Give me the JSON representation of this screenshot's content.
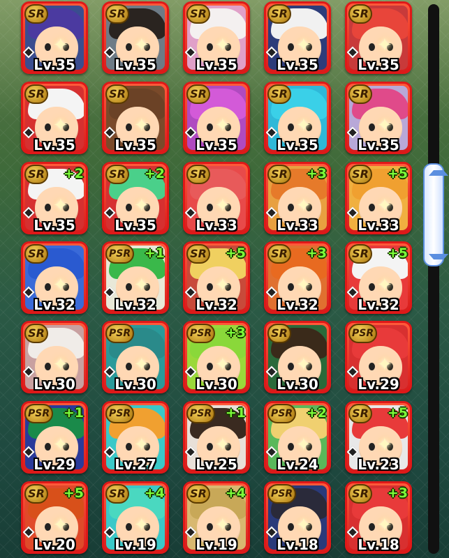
{
  "cards": [
    {
      "rarity": "SR",
      "level": "Lv.35",
      "bonus": "",
      "frame": "#e01818",
      "bg": "#3a4d8f",
      "hair": "#4b3aa0"
    },
    {
      "rarity": "SR",
      "level": "Lv.35",
      "bonus": "",
      "frame": "#e01818",
      "bg": "#6d7b86",
      "hair": "#2a2420"
    },
    {
      "rarity": "SR",
      "level": "Lv.35",
      "bonus": "",
      "frame": "#e01818",
      "bg": "#e0a0c8",
      "hair": "#f4f0f0"
    },
    {
      "rarity": "SR",
      "level": "Lv.35",
      "bonus": "",
      "frame": "#e01818",
      "bg": "#2d3c7a",
      "hair": "#f1f1f1"
    },
    {
      "rarity": "SR",
      "level": "Lv.35",
      "bonus": "",
      "frame": "#e01818",
      "bg": "#c83a3a",
      "hair": "#e8453a"
    },
    {
      "rarity": "SR",
      "level": "Lv.35",
      "bonus": "",
      "frame": "#e01818",
      "bg": "#d63030",
      "hair": "#f4f4f4"
    },
    {
      "rarity": "SR",
      "level": "Lv.35",
      "bonus": "",
      "frame": "#e01818",
      "bg": "#7a4a2a",
      "hair": "#6b4226"
    },
    {
      "rarity": "SR",
      "level": "Lv.35",
      "bonus": "",
      "frame": "#e01818",
      "bg": "#b04ac0",
      "hair": "#d35ad8"
    },
    {
      "rarity": "SR",
      "level": "Lv.35",
      "bonus": "",
      "frame": "#e01818",
      "bg": "#2fb8d8",
      "hair": "#3ad0e8"
    },
    {
      "rarity": "SR",
      "level": "Lv.35",
      "bonus": "",
      "frame": "#e01818",
      "bg": "#b8a8d8",
      "hair": "#e04a8a"
    },
    {
      "rarity": "SR",
      "level": "Lv.35",
      "bonus": "+2",
      "frame": "#e01818",
      "bg": "#d63030",
      "hair": "#f4f4f4"
    },
    {
      "rarity": "SR",
      "level": "Lv.35",
      "bonus": "+2",
      "frame": "#e01818",
      "bg": "#d63030",
      "hair": "#4ad08a"
    },
    {
      "rarity": "SR",
      "level": "Lv.33",
      "bonus": "",
      "frame": "#e01818",
      "bg": "#e84a4a",
      "hair": "#e85a5a"
    },
    {
      "rarity": "SR",
      "level": "Lv.33",
      "bonus": "+3",
      "frame": "#e01818",
      "bg": "#e8a040",
      "hair": "#e67a2a"
    },
    {
      "rarity": "SR",
      "level": "Lv.33",
      "bonus": "+5",
      "frame": "#e01818",
      "bg": "#f0b040",
      "hair": "#f0a030"
    },
    {
      "rarity": "SR",
      "level": "Lv.32",
      "bonus": "",
      "frame": "#e01818",
      "bg": "#3a6ad8",
      "hair": "#2a5ad0"
    },
    {
      "rarity": "PSR",
      "level": "Lv.32",
      "bonus": "+1",
      "frame": "#e01818",
      "bg": "#e8e8d8",
      "hair": "#3ab84a"
    },
    {
      "rarity": "SR",
      "level": "Lv.32",
      "bonus": "+5",
      "frame": "#e01818",
      "bg": "#c84a3a",
      "hair": "#f0d060"
    },
    {
      "rarity": "SR",
      "level": "Lv.32",
      "bonus": "+3",
      "frame": "#e01818",
      "bg": "#e07030",
      "hair": "#e86a20"
    },
    {
      "rarity": "SR",
      "level": "Lv.32",
      "bonus": "+5",
      "frame": "#e01818",
      "bg": "#e83a3a",
      "hair": "#f4f4f4"
    },
    {
      "rarity": "SR",
      "level": "Lv.30",
      "bonus": "",
      "frame": "#e01818",
      "bg": "#c8a0a0",
      "hair": "#f0ece8"
    },
    {
      "rarity": "PSR",
      "level": "Lv.30",
      "bonus": "",
      "frame": "#e01818",
      "bg": "#2a9a9a",
      "hair": "#2a8a8a"
    },
    {
      "rarity": "PSR",
      "level": "Lv.30",
      "bonus": "+3",
      "frame": "#e01818",
      "bg": "#9ad83a",
      "hair": "#8ad83a"
    },
    {
      "rarity": "SR",
      "level": "Lv.30",
      "bonus": "",
      "frame": "#e01818",
      "bg": "#2a6a3a",
      "hair": "#3a2a1a"
    },
    {
      "rarity": "PSR",
      "level": "Lv.29",
      "bonus": "",
      "frame": "#e01818",
      "bg": "#d83030",
      "hair": "#e83a3a"
    },
    {
      "rarity": "PSR",
      "level": "Lv.29",
      "bonus": "+1",
      "frame": "#e01818",
      "bg": "#2a3a9a",
      "hair": "#1a8a4a"
    },
    {
      "rarity": "PSR",
      "level": "Lv.27",
      "bonus": "",
      "frame": "#e01818",
      "bg": "#3ac8c8",
      "hair": "#f0a030"
    },
    {
      "rarity": "PSR",
      "level": "Lv.25",
      "bonus": "+1",
      "frame": "#e01818",
      "bg": "#e8e0d8",
      "hair": "#3a2a20"
    },
    {
      "rarity": "PSR",
      "level": "Lv.24",
      "bonus": "+2",
      "frame": "#e01818",
      "bg": "#5ab85a",
      "hair": "#f0d070"
    },
    {
      "rarity": "SR",
      "level": "Lv.23",
      "bonus": "+5",
      "frame": "#e01818",
      "bg": "#e8e8e8",
      "hair": "#e83a3a"
    },
    {
      "rarity": "SR",
      "level": "Lv.20",
      "bonus": "+5",
      "frame": "#e01818",
      "bg": "#e04a2a",
      "hair": "#d8501a"
    },
    {
      "rarity": "SR",
      "level": "Lv.19",
      "bonus": "+4",
      "frame": "#e01818",
      "bg": "#3ac8c8",
      "hair": "#4ad8c0"
    },
    {
      "rarity": "SR",
      "level": "Lv.19",
      "bonus": "+4",
      "frame": "#e01818",
      "bg": "#d8b870",
      "hair": "#c8a858"
    },
    {
      "rarity": "PSR",
      "level": "Lv.18",
      "bonus": "",
      "frame": "#e01818",
      "bg": "#2a3a7a",
      "hair": "#2a2a3a"
    },
    {
      "rarity": "SR",
      "level": "Lv.18",
      "bonus": "+3",
      "frame": "#e01818",
      "bg": "#d83030",
      "hair": "#e83a3a"
    }
  ],
  "icons": {
    "sparkle": "✦",
    "attribute_gem": "gem-icon"
  },
  "scrollbar": {
    "position": 0.42
  }
}
